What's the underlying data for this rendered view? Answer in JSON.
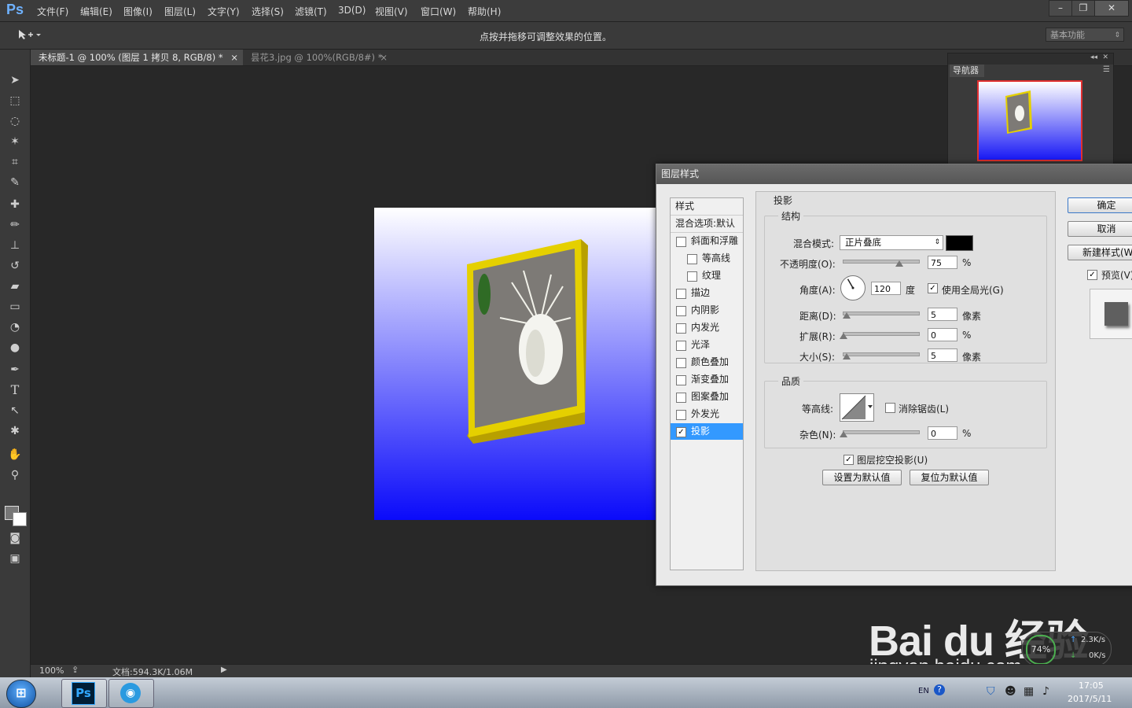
{
  "app": {
    "logo": "Ps"
  },
  "menu": [
    "文件(F)",
    "编辑(E)",
    "图像(I)",
    "图层(L)",
    "文字(Y)",
    "选择(S)",
    "滤镜(T)",
    "3D(D)",
    "视图(V)",
    "窗口(W)",
    "帮助(H)"
  ],
  "window_controls": {
    "minimize": "–",
    "restore": "❐",
    "close": "✕"
  },
  "options": {
    "hint": "点按并拖移可调整效果的位置。",
    "workspace": "基本功能"
  },
  "tabs": [
    {
      "label": "未标题-1 @ 100% (图层 1 拷贝 8, RGB/8) *",
      "close": "×"
    },
    {
      "label": "昙花3.jpg @ 100%(RGB/8#) *",
      "close": "×"
    }
  ],
  "navigator": {
    "title": "导航器"
  },
  "dialog": {
    "title": "图层样式",
    "styles_header": "样式",
    "blend_options": "混合选项:默认",
    "style_items": [
      {
        "label": "斜面和浮雕",
        "checked": false,
        "indent": false
      },
      {
        "label": "等高线",
        "checked": false,
        "indent": true
      },
      {
        "label": "纹理",
        "checked": false,
        "indent": true
      },
      {
        "label": "描边",
        "checked": false,
        "indent": false
      },
      {
        "label": "内阴影",
        "checked": false,
        "indent": false
      },
      {
        "label": "内发光",
        "checked": false,
        "indent": false
      },
      {
        "label": "光泽",
        "checked": false,
        "indent": false
      },
      {
        "label": "颜色叠加",
        "checked": false,
        "indent": false
      },
      {
        "label": "渐变叠加",
        "checked": false,
        "indent": false
      },
      {
        "label": "图案叠加",
        "checked": false,
        "indent": false
      },
      {
        "label": "外发光",
        "checked": false,
        "indent": false
      },
      {
        "label": "投影",
        "checked": true,
        "indent": false
      }
    ],
    "section_title": "投影",
    "structure": {
      "title": "结构",
      "blend_mode_label": "混合模式:",
      "blend_mode_value": "正片叠底",
      "color": "#000000",
      "opacity_label": "不透明度(O):",
      "opacity": "75",
      "opacity_unit": "%",
      "angle_label": "角度(A):",
      "angle": "120",
      "angle_unit": "度",
      "global_light_label": "使用全局光(G)",
      "global_light": true,
      "distance_label": "距离(D):",
      "distance": "5",
      "distance_unit": "像素",
      "spread_label": "扩展(R):",
      "spread": "0",
      "spread_unit": "%",
      "size_label": "大小(S):",
      "size": "5",
      "size_unit": "像素"
    },
    "quality": {
      "title": "品质",
      "contour_label": "等高线:",
      "antialias_label": "消除锯齿(L)",
      "antialias": false,
      "noise_label": "杂色(N):",
      "noise": "0",
      "noise_unit": "%"
    },
    "knockout_label": "图层挖空投影(U)",
    "knockout": true,
    "set_default": "设置为默认值",
    "reset_default": "复位为默认值",
    "ok": "确定",
    "cancel": "取消",
    "new_style": "新建样式(W)...",
    "preview_label": "预览(V)",
    "preview": true
  },
  "status": {
    "zoom": "100%",
    "doc": "文档:594.3K/1.06M"
  },
  "watermark": {
    "brand": "Bai du 经验",
    "url": "jingyan.baidu.com"
  },
  "network": {
    "percent": "74%",
    "up": "2.3K/s",
    "down": "0K/s"
  },
  "taskbar": {
    "lang": "EN",
    "time": "17:05",
    "date": "2017/5/11"
  },
  "colors": {
    "accent": "#3399ff",
    "canvas_top": "#ffffff",
    "canvas_bottom": "#0a0afa",
    "frame": "#e5d000"
  }
}
